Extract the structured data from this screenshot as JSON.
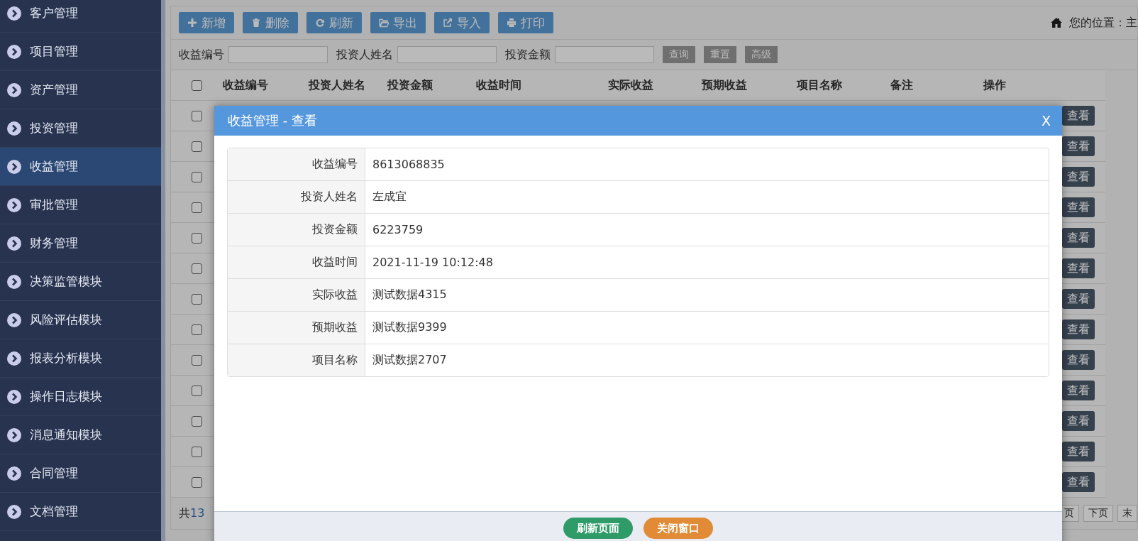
{
  "sidebar": {
    "items": [
      {
        "label": "客户管理",
        "selected": false
      },
      {
        "label": "项目管理",
        "selected": false
      },
      {
        "label": "资产管理",
        "selected": false
      },
      {
        "label": "投资管理",
        "selected": false
      },
      {
        "label": "收益管理",
        "selected": true
      },
      {
        "label": "审批管理",
        "selected": false
      },
      {
        "label": "财务管理",
        "selected": false
      },
      {
        "label": "决策监管模块",
        "selected": false
      },
      {
        "label": "风险评估模块",
        "selected": false
      },
      {
        "label": "报表分析模块",
        "selected": false
      },
      {
        "label": "操作日志模块",
        "selected": false
      },
      {
        "label": "消息通知模块",
        "selected": false
      },
      {
        "label": "合同管理",
        "selected": false
      },
      {
        "label": "文档管理",
        "selected": false
      }
    ]
  },
  "toolbar": {
    "buttons": [
      {
        "label": "新增"
      },
      {
        "label": "删除"
      },
      {
        "label": "刷新"
      },
      {
        "label": "导出"
      },
      {
        "label": "导入"
      },
      {
        "label": "打印"
      }
    ],
    "breadcrumb": "您的位置：主"
  },
  "search": {
    "fields": [
      {
        "label": "收益编号"
      },
      {
        "label": "投资人姓名"
      },
      {
        "label": "投资金额"
      }
    ],
    "buttons": [
      "查询",
      "重置",
      "高级"
    ]
  },
  "table": {
    "header_checked": false,
    "columns": [
      "收益编号",
      "投资人姓名",
      "投资金额",
      "收益时间",
      "实际收益",
      "预期收益",
      "项目名称",
      "备注",
      "操作"
    ],
    "rows": [
      {
        "checked": false,
        "action": "查看"
      },
      {
        "checked": false,
        "action": "查看"
      },
      {
        "checked": false,
        "action": "查看"
      },
      {
        "checked": false,
        "action": "查看"
      },
      {
        "checked": false,
        "action": "查看"
      },
      {
        "checked": false,
        "action": "查看"
      },
      {
        "checked": false,
        "action": "查看"
      },
      {
        "checked": false,
        "action": "查看"
      },
      {
        "checked": false,
        "action": "查看"
      },
      {
        "checked": false,
        "action": "查看"
      },
      {
        "checked": false,
        "action": "查看"
      },
      {
        "checked": false,
        "action": "查看"
      },
      {
        "checked": false,
        "action": "查看"
      }
    ]
  },
  "footer": {
    "prefix": "共",
    "count": "13",
    "pagination": [
      "页",
      "下页",
      "末"
    ]
  },
  "dialog": {
    "title": "收益管理 - 查看",
    "close": "X",
    "fields": [
      {
        "label": "收益编号",
        "value": "8613068835"
      },
      {
        "label": "投资人姓名",
        "value": "左成宜"
      },
      {
        "label": "投资金额",
        "value": "6223759"
      },
      {
        "label": "收益时间",
        "value": "2021-11-19 10:12:48"
      },
      {
        "label": "实际收益",
        "value": "测试数据4315"
      },
      {
        "label": "预期收益",
        "value": "测试数据9399"
      },
      {
        "label": "项目名称",
        "value": "测试数据2707"
      }
    ],
    "buttons": [
      {
        "label": "刷新页面",
        "kind": "success"
      },
      {
        "label": "关闭窗口",
        "kind": "warning"
      }
    ]
  }
}
